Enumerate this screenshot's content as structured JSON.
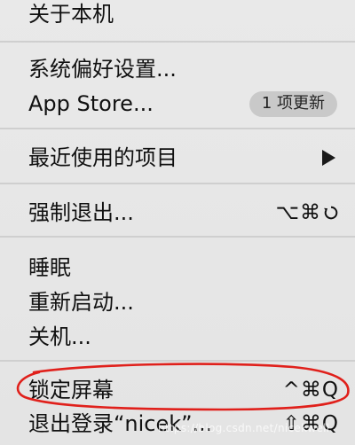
{
  "menu": {
    "about": "关于本机",
    "system_prefs": "系统偏好设置...",
    "app_store": "App Store...",
    "app_store_badge": "1 项更新",
    "recent_items": "最近使用的项目",
    "force_quit": "强制退出...",
    "force_quit_shortcut": "⌥⌘",
    "sleep": "睡眠",
    "restart": "重新启动...",
    "shutdown": "关机...",
    "lock_screen": "锁定屏幕",
    "lock_screen_shortcut": "^⌘Q",
    "logout": "退出登录“nicek”...",
    "logout_shortcut": "⇧⌘Q"
  },
  "watermark": "https://blog.csdn.net/nicekwell",
  "colors": {
    "menu_bg": "#e6e6e6",
    "separator": "#cfcfcf",
    "badge_bg": "#c9c9c9",
    "highlight_annotation": "#e0201b"
  },
  "icons": {
    "submenu": "triangle-right",
    "force_quit_extra": "restore-arrow"
  }
}
